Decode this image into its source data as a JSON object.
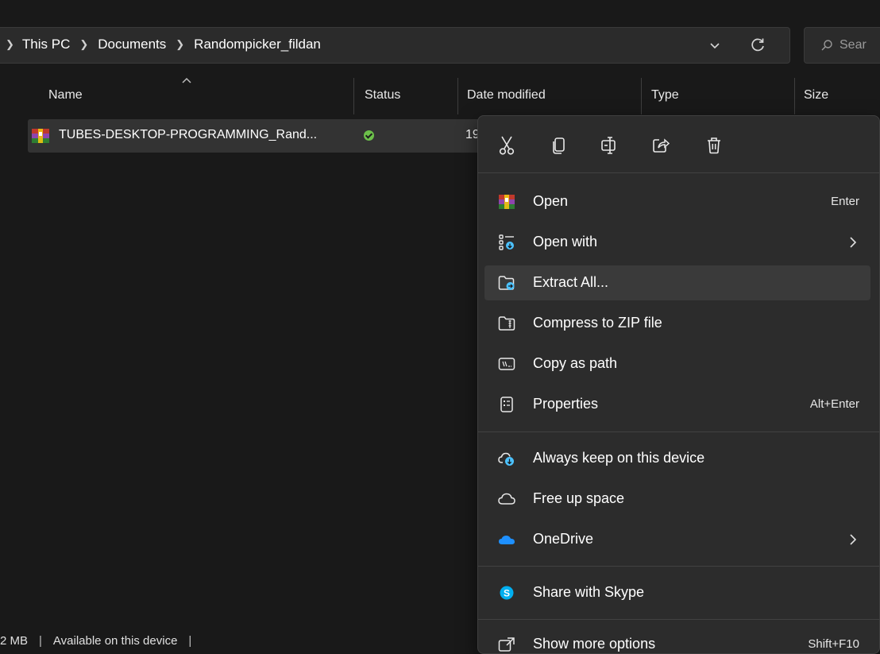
{
  "address_bar": {
    "breadcrumbs": [
      "This PC",
      "Documents",
      "Randompicker_fildan"
    ],
    "search_placeholder": "Sear"
  },
  "columns": {
    "name": "Name",
    "status": "Status",
    "date_modified": "Date modified",
    "type": "Type",
    "size": "Size"
  },
  "files": [
    {
      "name": "TUBES-DESKTOP-PROGRAMMING_Rand...",
      "status": "available",
      "date": "19"
    }
  ],
  "status_bar": {
    "size": "2 MB",
    "availability": "Available on this device"
  },
  "context_menu": {
    "quick_actions": [
      "cut-icon",
      "copy-icon",
      "rename-icon",
      "share-icon",
      "delete-icon"
    ],
    "items": [
      {
        "label": "Open",
        "shortcut": "Enter",
        "icon": "winrar-archive-icon"
      },
      {
        "label": "Open with",
        "icon": "open-with-icon",
        "submenu": true
      },
      {
        "label": "Extract All...",
        "icon": "extract-folder-icon",
        "highlighted": true
      },
      {
        "label": "Compress to ZIP file",
        "icon": "zip-folder-icon"
      },
      {
        "label": "Copy as path",
        "icon": "copy-path-icon"
      },
      {
        "label": "Properties",
        "shortcut": "Alt+Enter",
        "icon": "properties-icon"
      },
      {
        "label": "Always keep on this device",
        "icon": "cloud-sync-icon"
      },
      {
        "label": "Free up space",
        "icon": "cloud-outline-icon"
      },
      {
        "label": "OneDrive",
        "icon": "onedrive-icon",
        "submenu": true
      },
      {
        "label": "Share with Skype",
        "icon": "skype-icon"
      },
      {
        "label": "Show more options",
        "shortcut": "Shift+F10",
        "icon": "show-more-icon"
      }
    ]
  },
  "colors": {
    "background": "#191919",
    "menu": "#2c2c2c",
    "selected_row": "#333333",
    "accent": "#4cc2ff",
    "status_ok": "#6cc04a",
    "onedrive": "#1e90ff",
    "skype": "#00aff0"
  }
}
